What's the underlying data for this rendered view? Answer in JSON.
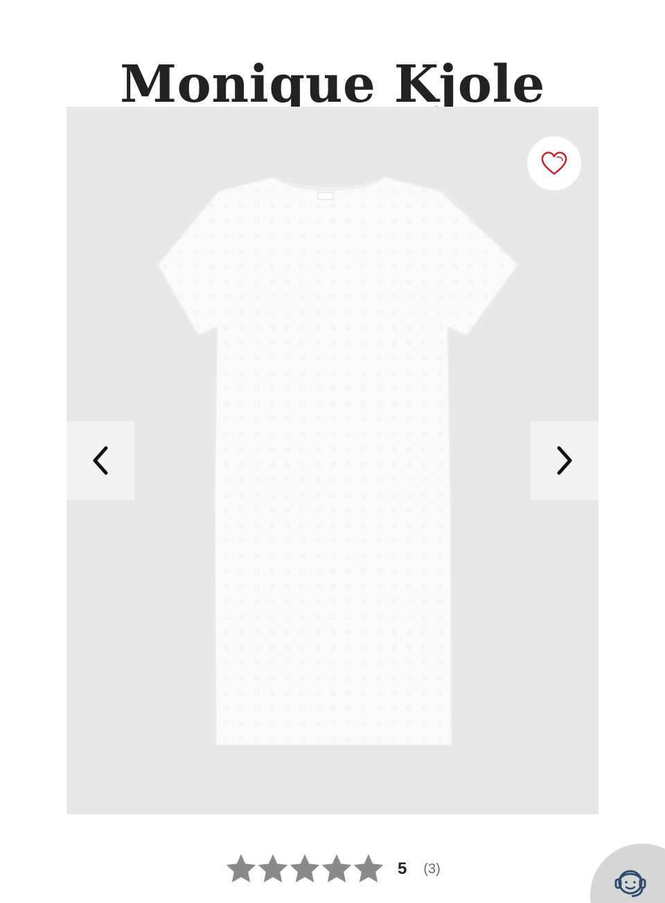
{
  "product": {
    "title": "Monique Kjole"
  },
  "gallery": {
    "image_alt": "white lace t-shirt dress",
    "favorite_icon": "heart-icon",
    "prev_icon": "chevron-left-icon",
    "next_icon": "chevron-right-icon"
  },
  "rating": {
    "stars": 5,
    "max_stars": 5,
    "value": "5",
    "count": "(3)",
    "star_color": "#8a8a8a"
  },
  "support": {
    "icon": "customer-support-icon"
  },
  "colors": {
    "heart": "#b8282c",
    "gallery_bg": "#e8e8e8",
    "title": "#222222"
  }
}
